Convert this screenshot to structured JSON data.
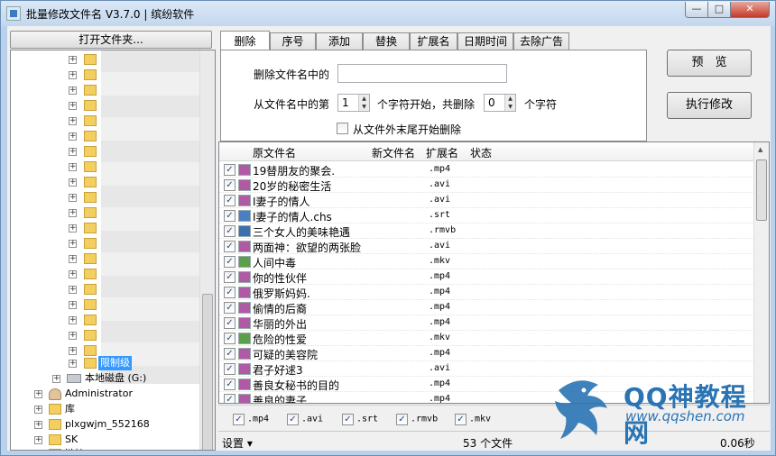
{
  "window": {
    "title": "批量修改文件名 V3.7.0 | 缤纷软件",
    "min_glyph": "—",
    "max_glyph": "□",
    "close_glyph": "✕"
  },
  "left": {
    "open_folder_label": "打开文件夹...",
    "tree": {
      "selected_folder": "限制级",
      "drive_label": "本地磁盘 (G:)",
      "items": [
        "Administrator",
        "库",
        "plxgwjm_552168",
        "SK",
        "链接"
      ]
    }
  },
  "tabs": [
    "删除",
    "序号",
    "添加",
    "替换",
    "扩展名",
    "日期时间",
    "去除广告"
  ],
  "active_tab": "删除",
  "delete_panel": {
    "delete_in_name_label": "删除文件名中的",
    "delete_in_name_value": "",
    "from_position_label": "从文件名中的第",
    "start_value": "1",
    "start_suffix": "个字符开始，共删除",
    "count_value": "0",
    "count_suffix": "个字符",
    "from_end_label": "从文件外末尾开始删除",
    "from_end_checked": false
  },
  "buttons": {
    "preview": "预　览",
    "execute": "执行修改"
  },
  "list": {
    "headers": {
      "original": "原文件名",
      "new_name": "新文件名",
      "ext": "扩展名",
      "status": "状态"
    },
    "rows": [
      {
        "name": "19替朋友的聚会.",
        "ext": ".mp4",
        "icon": "mp4-file-icon",
        "color": "#b05aa6"
      },
      {
        "name": "20岁的秘密生活",
        "ext": ".avi",
        "icon": "avi-file-icon",
        "color": "#b05aa6"
      },
      {
        "name": "I妻子的情人",
        "ext": ".avi",
        "icon": "avi-file-icon",
        "color": "#b05aa6"
      },
      {
        "name": "I妻子的情人.chs",
        "ext": ".srt",
        "icon": "srt-file-icon",
        "color": "#4a7fc1"
      },
      {
        "name": "三个女人的美味艳遇",
        "ext": ".rmvb",
        "icon": "rmvb-file-icon",
        "color": "#3d6fb0"
      },
      {
        "name": "两面神：欲望的两张脸",
        "ext": ".avi",
        "icon": "avi-file-icon",
        "color": "#b05aa6"
      },
      {
        "name": "人间中毒",
        "ext": ".mkv",
        "icon": "mkv-file-icon",
        "color": "#5aa04a"
      },
      {
        "name": "你的性伙伴",
        "ext": ".mp4",
        "icon": "mp4-file-icon",
        "color": "#b05aa6"
      },
      {
        "name": "俄罗斯妈妈.",
        "ext": ".mp4",
        "icon": "mp4-file-icon",
        "color": "#b05aa6"
      },
      {
        "name": "偷情的后裔",
        "ext": ".mp4",
        "icon": "mp4-file-icon",
        "color": "#b05aa6"
      },
      {
        "name": "华丽的外出",
        "ext": ".mp4",
        "icon": "mp4-file-icon",
        "color": "#b05aa6"
      },
      {
        "name": "危险的性爱",
        "ext": ".mkv",
        "icon": "mkv-file-icon",
        "color": "#5aa04a"
      },
      {
        "name": "可疑的美容院",
        "ext": ".mp4",
        "icon": "mp4-file-icon",
        "color": "#b05aa6"
      },
      {
        "name": "君子好逑3",
        "ext": ".avi",
        "icon": "avi-file-icon",
        "color": "#b05aa6"
      },
      {
        "name": "善良女秘书的目的",
        "ext": ".mp4",
        "icon": "mp4-file-icon",
        "color": "#b05aa6"
      },
      {
        "name": "善良的妻子",
        "ext": ".mp4",
        "icon": "mp4-file-icon",
        "color": "#b05aa6"
      }
    ]
  },
  "filters": [
    ".mp4",
    ".avi",
    ".srt",
    ".rmvb",
    ".mkv"
  ],
  "status": {
    "settings_label": "设置",
    "settings_arrow": "▾",
    "file_count": "53 个文件",
    "elapsed": "0.06秒"
  },
  "watermark": {
    "brand": "QQ神教程网",
    "url": "www.qqshen.com"
  }
}
